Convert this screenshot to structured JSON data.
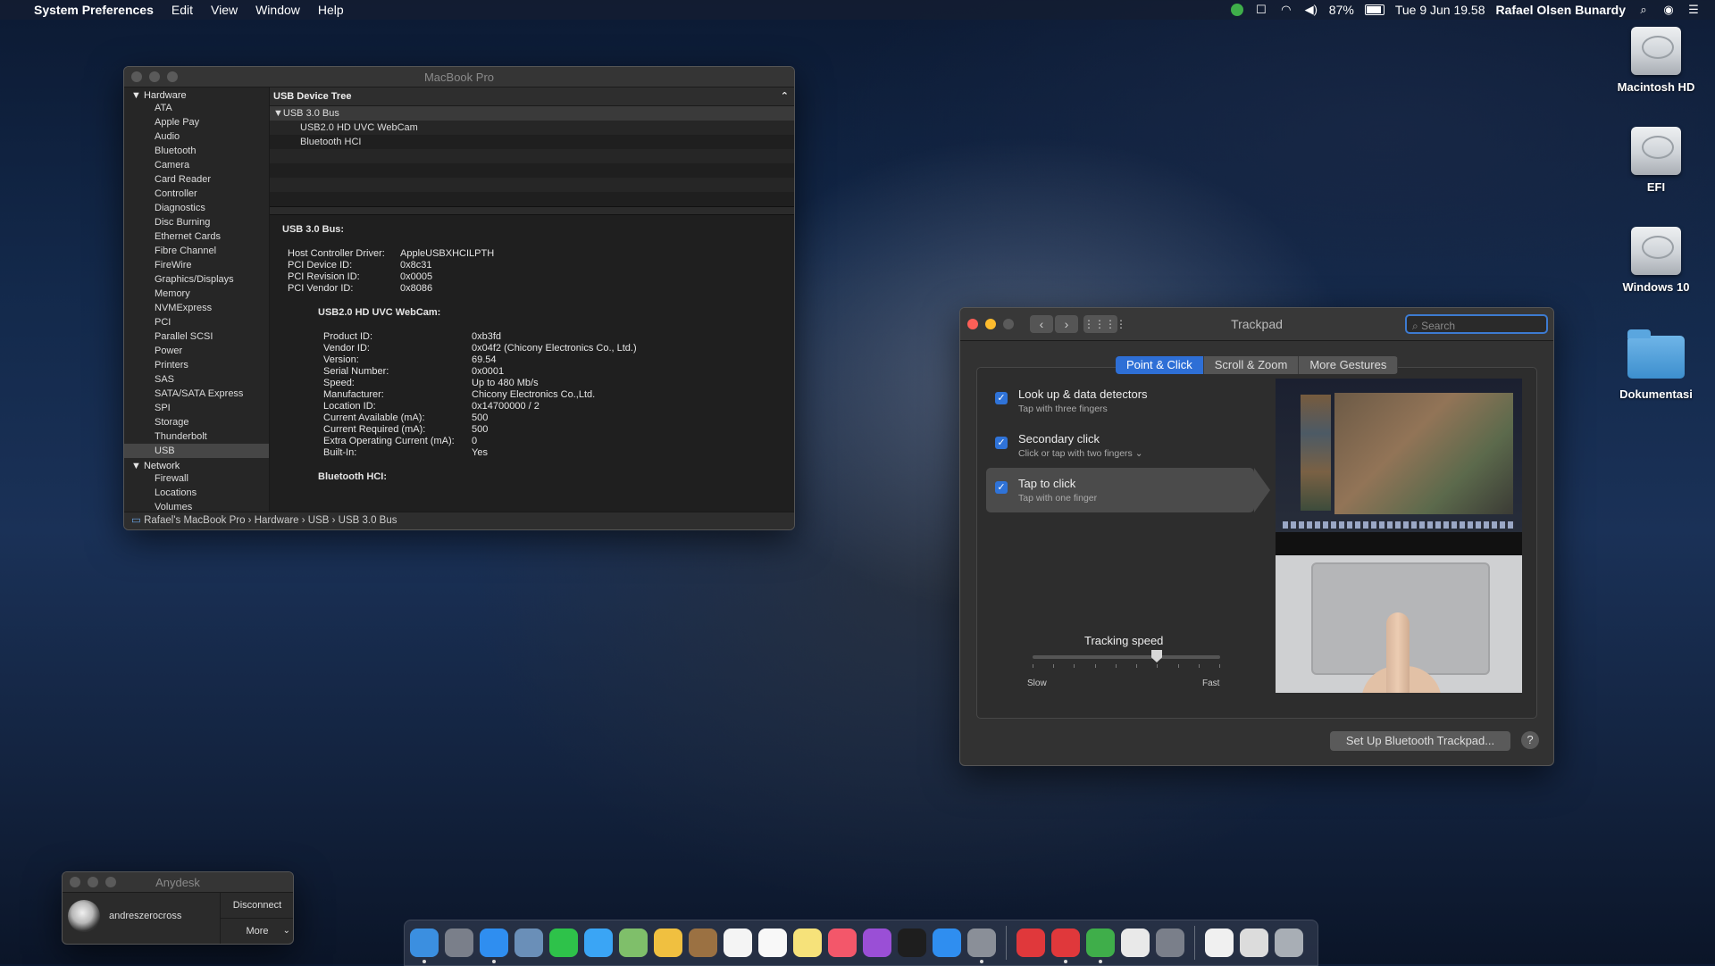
{
  "menubar": {
    "apple_glyph": "",
    "app_name": "System Preferences",
    "menus": [
      "Edit",
      "View",
      "Window",
      "Help"
    ],
    "battery_percent": "87%",
    "battery_level": 0.87,
    "datetime": "Tue 9 Jun  19.58",
    "user": "Rafael Olsen Bunardy"
  },
  "sysinfo": {
    "title": "MacBook Pro",
    "sidebar": {
      "hardware_label": "Hardware",
      "hardware_items": [
        "ATA",
        "Apple Pay",
        "Audio",
        "Bluetooth",
        "Camera",
        "Card Reader",
        "Controller",
        "Diagnostics",
        "Disc Burning",
        "Ethernet Cards",
        "Fibre Channel",
        "FireWire",
        "Graphics/Displays",
        "Memory",
        "NVMExpress",
        "PCI",
        "Parallel SCSI",
        "Power",
        "Printers",
        "SAS",
        "SATA/SATA Express",
        "SPI",
        "Storage",
        "Thunderbolt",
        "USB"
      ],
      "selected": "USB",
      "network_label": "Network",
      "network_items": [
        "Firewall",
        "Locations",
        "Volumes"
      ]
    },
    "tree": {
      "header": "USB Device Tree",
      "bus": "USB 3.0 Bus",
      "devices": [
        "USB2.0 HD UVC WebCam",
        "Bluetooth HCI"
      ]
    },
    "detail": {
      "bus_heading": "USB 3.0 Bus:",
      "bus_props": [
        {
          "k": "Host Controller Driver:",
          "v": "AppleUSBXHCILPTH"
        },
        {
          "k": "PCI Device ID:",
          "v": "0x8c31"
        },
        {
          "k": "PCI Revision ID:",
          "v": "0x0005"
        },
        {
          "k": "PCI Vendor ID:",
          "v": "0x8086"
        }
      ],
      "webcam_heading": "USB2.0 HD UVC WebCam:",
      "webcam_props": [
        {
          "k": "Product ID:",
          "v": "0xb3fd"
        },
        {
          "k": "Vendor ID:",
          "v": "0x04f2  (Chicony Electronics Co., Ltd.)"
        },
        {
          "k": "Version:",
          "v": "69.54"
        },
        {
          "k": "Serial Number:",
          "v": "0x0001"
        },
        {
          "k": "Speed:",
          "v": "Up to 480 Mb/s"
        },
        {
          "k": "Manufacturer:",
          "v": "Chicony Electronics Co.,Ltd."
        },
        {
          "k": "Location ID:",
          "v": "0x14700000 / 2"
        },
        {
          "k": "Current Available (mA):",
          "v": "500"
        },
        {
          "k": "Current Required (mA):",
          "v": "500"
        },
        {
          "k": "Extra Operating Current (mA):",
          "v": "0"
        },
        {
          "k": "Built-In:",
          "v": "Yes"
        }
      ],
      "bt_heading": "Bluetooth HCI:"
    },
    "path": "Rafael's MacBook Pro  ›  Hardware  ›  USB  ›  USB 3.0 Bus"
  },
  "trackpad": {
    "title": "Trackpad",
    "search_placeholder": "Search",
    "tabs": [
      "Point & Click",
      "Scroll & Zoom",
      "More Gestures"
    ],
    "active_tab": "Point & Click",
    "options": [
      {
        "title": "Look up & data detectors",
        "subtitle": "Tap with three fingers",
        "checked": true
      },
      {
        "title": "Secondary click",
        "subtitle": "Click or tap with two fingers ⌄",
        "checked": true
      },
      {
        "title": "Tap to click",
        "subtitle": "Tap with one finger",
        "checked": true
      }
    ],
    "tracking_label": "Tracking speed",
    "slow_label": "Slow",
    "fast_label": "Fast",
    "tracking_value": 0.66,
    "setup_button": "Set Up Bluetooth Trackpad...",
    "help_button": "?"
  },
  "desktop_icons": [
    {
      "label": "Macintosh HD",
      "icon": "drive-icon"
    },
    {
      "label": "EFI",
      "icon": "drive-icon"
    },
    {
      "label": "Windows 10",
      "icon": "drive-icon"
    },
    {
      "label": "Dokumentasi",
      "icon": "folder-icon"
    }
  ],
  "anydesk": {
    "title": "Anydesk",
    "user": "andreszerocross",
    "disconnect": "Disconnect",
    "more": "More"
  },
  "dock_apps": [
    {
      "name": "finder-icon",
      "color": "#3b8fe0",
      "running": true
    },
    {
      "name": "launchpad-icon",
      "color": "#7a7f8a",
      "running": false
    },
    {
      "name": "safari-icon",
      "color": "#2f8ef0",
      "running": true
    },
    {
      "name": "preview-icon",
      "color": "#6a8fb8",
      "running": false
    },
    {
      "name": "facetime-icon",
      "color": "#2ec24a",
      "running": false
    },
    {
      "name": "messages-icon",
      "color": "#3aa5f5",
      "running": false
    },
    {
      "name": "maps-icon",
      "color": "#7fbf6a",
      "running": false
    },
    {
      "name": "photos-icon",
      "color": "#f0c040",
      "running": false
    },
    {
      "name": "notes-brown-icon",
      "color": "#9b7142",
      "running": false
    },
    {
      "name": "calendar-icon",
      "color": "#f4f4f4",
      "running": false
    },
    {
      "name": "reminders-icon",
      "color": "#f8f8f8",
      "running": false
    },
    {
      "name": "notes-icon",
      "color": "#f6e27a",
      "running": false
    },
    {
      "name": "music-icon",
      "color": "#f3576a",
      "running": false
    },
    {
      "name": "podcasts-icon",
      "color": "#9a4fd6",
      "running": false
    },
    {
      "name": "apple-tv-icon",
      "color": "#1e1e1e",
      "running": false
    },
    {
      "name": "app-store-icon",
      "color": "#2f8ef0",
      "running": false
    },
    {
      "name": "system-preferences-icon",
      "color": "#8a8f98",
      "running": true
    },
    {
      "name": "anydesk-icon",
      "color": "#e0383b",
      "running": false
    },
    {
      "name": "anydesk-2-icon",
      "color": "#e0383b",
      "running": true
    },
    {
      "name": "globe-icon",
      "color": "#3fae4a",
      "running": true
    },
    {
      "name": "textedit-icon",
      "color": "#e9e9e9",
      "running": false
    },
    {
      "name": "utility-icon",
      "color": "#7a7f8a",
      "running": false
    },
    {
      "name": "document-icon",
      "color": "#f0f0f0",
      "running": false
    },
    {
      "name": "screenshot-icon",
      "color": "#dcdcdc",
      "running": false
    },
    {
      "name": "trash-icon",
      "color": "#a8aeb5",
      "running": false
    }
  ]
}
